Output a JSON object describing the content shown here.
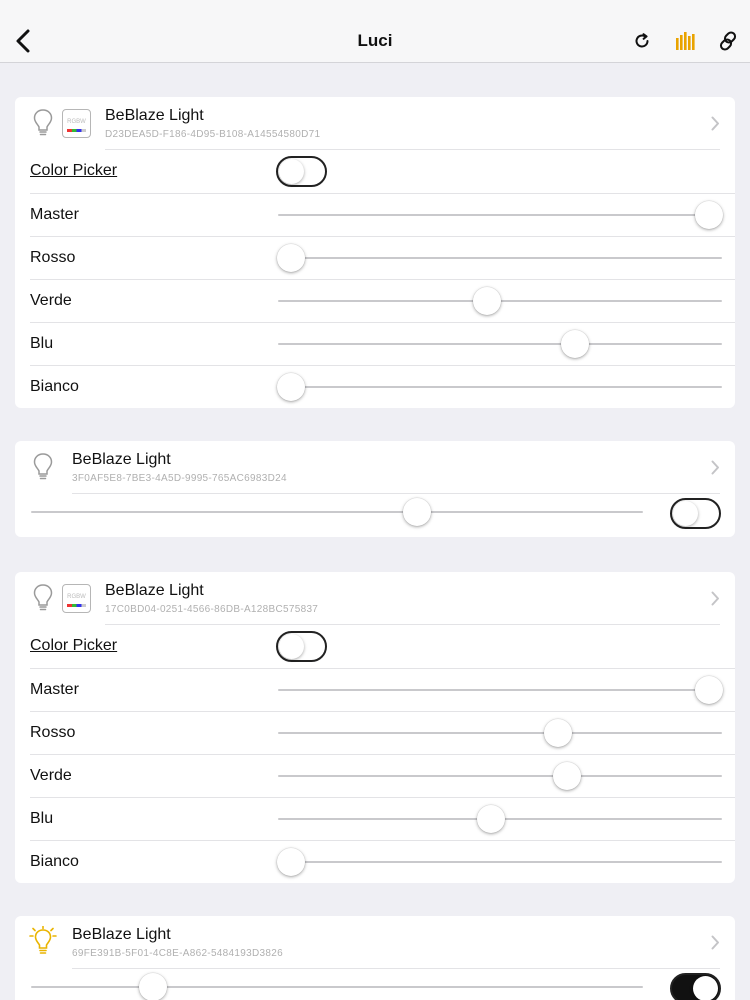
{
  "nav": {
    "title": "Luci",
    "back_icon": "chevron-left-icon",
    "actions": [
      "refresh-icon",
      "bars-chart-icon",
      "link-icon"
    ],
    "accent": "#e9a300"
  },
  "cards": [
    {
      "name": "BeBlaze Light",
      "uuid": "D23DEA5D-F186-4D95-B108-A14554580D71",
      "rgbw_badge": "RGBW",
      "color_picker_label": "Color Picker",
      "color_picker_on": false,
      "channels": [
        {
          "label": "Master",
          "value": 0.97
        },
        {
          "label": "Rosso",
          "value": 0.03
        },
        {
          "label": "Verde",
          "value": 0.47
        },
        {
          "label": "Blu",
          "value": 0.67
        },
        {
          "label": "Bianco",
          "value": 0.03
        }
      ]
    },
    {
      "name": "BeBlaze Light",
      "uuid": "3F0AF5E8-7BE3-4A5D-9995-765AC6983D24",
      "brightness": 0.63,
      "on": false
    },
    {
      "name": "BeBlaze Light",
      "uuid": "17C0BD04-0251-4566-86DB-A128BC575837",
      "rgbw_badge": "RGBW",
      "color_picker_label": "Color Picker",
      "color_picker_on": false,
      "channels": [
        {
          "label": "Master",
          "value": 0.97
        },
        {
          "label": "Rosso",
          "value": 0.63
        },
        {
          "label": "Verde",
          "value": 0.65
        },
        {
          "label": "Blu",
          "value": 0.48
        },
        {
          "label": "Bianco",
          "value": 0.03
        }
      ]
    },
    {
      "name": "BeBlaze Light",
      "uuid": "69FE391B-5F01-4C8E-A862-5484193D3826",
      "brightness": 0.2,
      "on": true,
      "bulb_lit": true
    }
  ]
}
